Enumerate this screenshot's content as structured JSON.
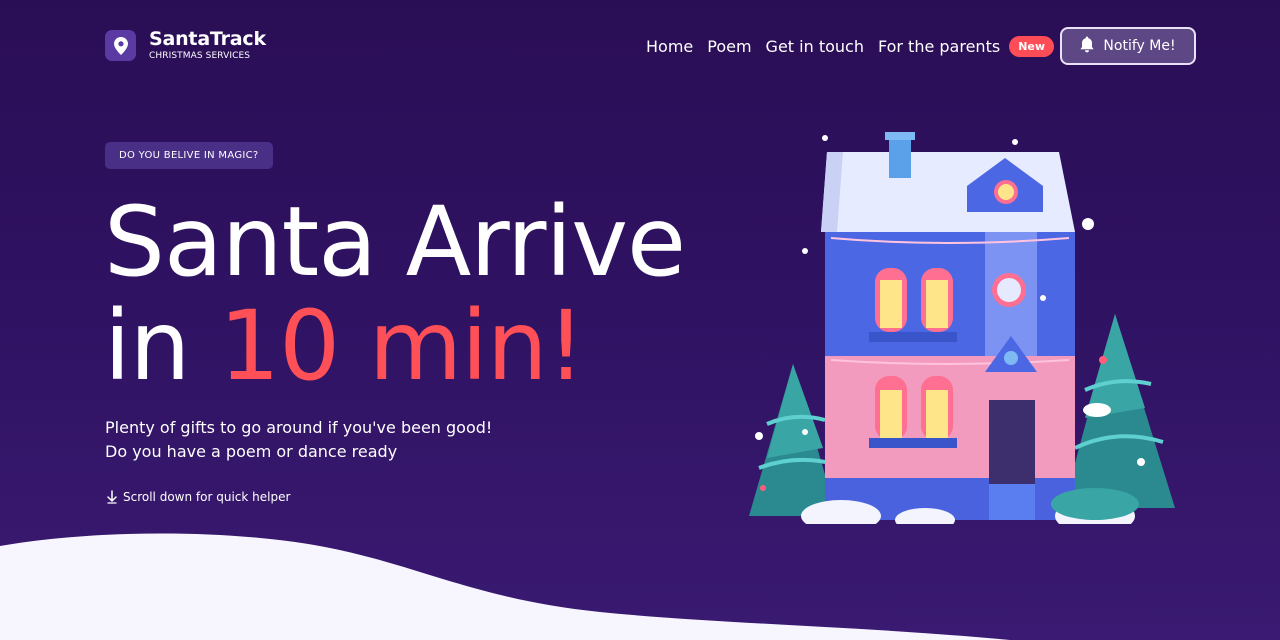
{
  "brand": {
    "title": "SantaTrack",
    "subtitle": "CHRISTMAS SERVICES",
    "icon": "map-pin-icon"
  },
  "nav": {
    "items": [
      {
        "label": "Home"
      },
      {
        "label": "Poem"
      },
      {
        "label": "Get in touch"
      },
      {
        "label": "For the parents"
      }
    ],
    "badge": "New"
  },
  "notify": {
    "label": "Notify Me!",
    "icon": "bell-icon"
  },
  "hero": {
    "pill": "DO YOU BELIVE IN MAGIC?",
    "line1": "Santa Arrive",
    "line2_prefix": "in ",
    "line2_accent": "10 min!",
    "sub1": "Plenty of gifts to go around if you've been good!",
    "sub2": "Do you have a poem or dance ready",
    "scroll": "Scroll down for quick helper"
  },
  "colors": {
    "background": "#2e1160",
    "accent": "#ff4f57",
    "snow": "#f7f5fd"
  }
}
